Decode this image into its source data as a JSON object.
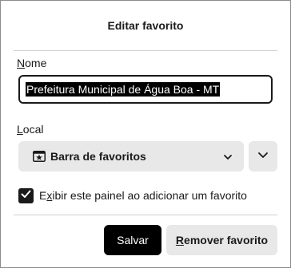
{
  "dialog": {
    "title": "Editar favorito"
  },
  "name_field": {
    "label_underlined": "N",
    "label_rest": "ome",
    "value": "Prefeitura Municipal de Água Boa - MT"
  },
  "location": {
    "label_underlined": "L",
    "label_rest": "ocal",
    "selected": "Barra de favoritos",
    "icon": "bookmarks-toolbar-icon"
  },
  "checkbox": {
    "label_pre": "E",
    "label_underlined": "x",
    "label_rest": "ibir este painel ao adicionar um favorito",
    "checked": true
  },
  "buttons": {
    "save": "Salvar",
    "remove_underlined": "R",
    "remove_rest": "emover favorito"
  }
}
